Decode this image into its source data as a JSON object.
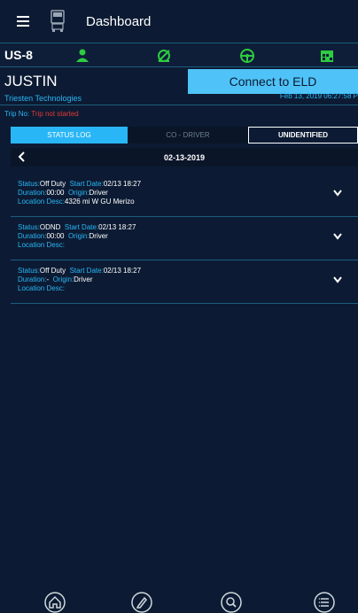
{
  "header": {
    "title": "Dashboard",
    "menu_icon": "hamburger-menu-icon",
    "logo_icon": "truck-icon"
  },
  "status_bar": {
    "region": "US-8",
    "icons": [
      "driver-status-icon",
      "driving-status-icon",
      "steering-wheel-icon",
      "calendar-icon"
    ],
    "icon_color": "#2ecc40"
  },
  "driver": {
    "name": "JUSTIN",
    "company": "Triesten Technologies"
  },
  "eld": {
    "connect_label": "Connect to ELD",
    "datetime": "Feb 13, 2019 06:27:58 P"
  },
  "trip": {
    "label": "Trip No:",
    "value": "Trip not started"
  },
  "tabs": {
    "status_log": "STATUS LOG",
    "co_driver": "CO - DRIVER",
    "unidentified": "UNIDENTIFIED"
  },
  "date_nav": {
    "date": "02-13-2019"
  },
  "field_labels": {
    "status": "Status:",
    "start_date": "Start Date:",
    "duration": "Duration:",
    "origin": "Origin:",
    "location": "Location Desc:"
  },
  "logs": [
    {
      "status": "Off Duty",
      "start_date": "02/13 18:27",
      "duration": "00:00",
      "origin": "Driver",
      "location": "4326 mi W GU Merizo"
    },
    {
      "status": "ODND",
      "start_date": "02/13 18:27",
      "duration": "00:00",
      "origin": "Driver",
      "location": ""
    },
    {
      "status": "Off Duty",
      "start_date": "02/13 18:27",
      "duration": "-",
      "origin": "Driver",
      "location": ""
    }
  ],
  "bottom_nav": [
    "home-icon",
    "edit-icon",
    "search-icon",
    "list-icon"
  ],
  "colors": {
    "background": "#0c1b33",
    "accent": "#29b6f6",
    "button": "#4fc3f7",
    "alert": "#e53935"
  }
}
